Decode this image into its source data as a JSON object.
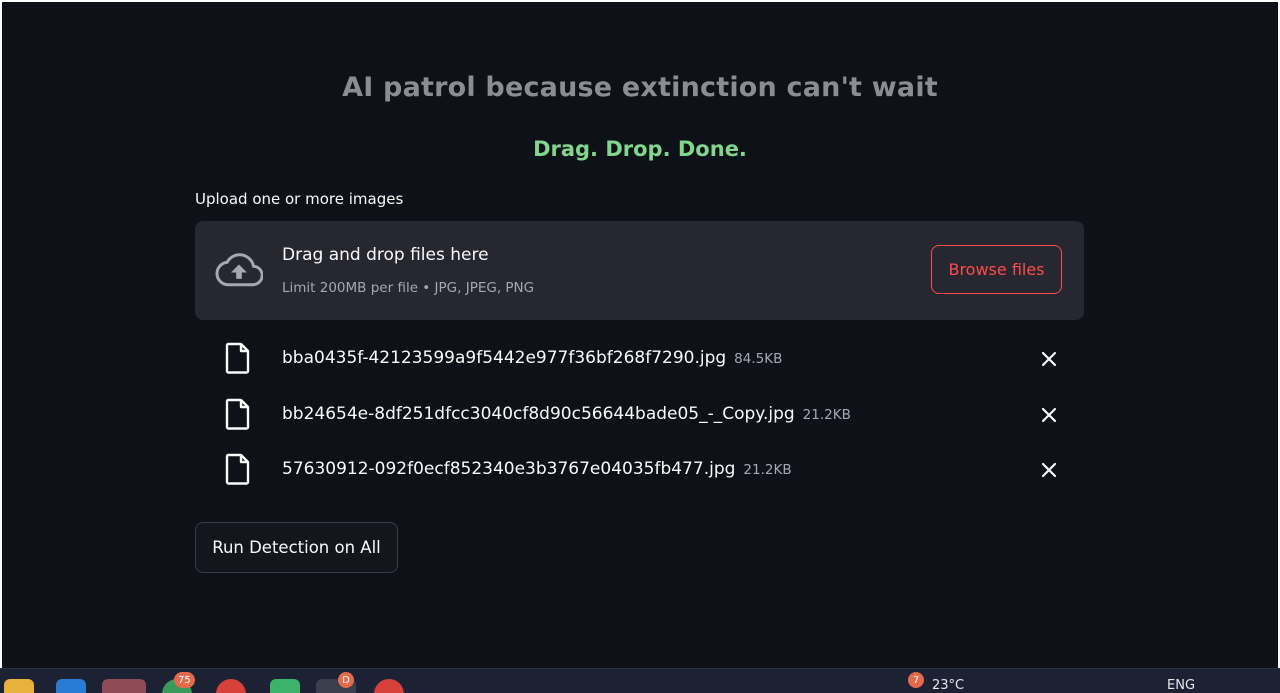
{
  "header": {
    "title": "AI patrol because extinction can't wait",
    "subtitle": "Drag. Drop. Done."
  },
  "uploader": {
    "label": "Upload one or more images",
    "drop_text": "Drag and drop files here",
    "limit_text": "Limit 200MB per file • JPG, JPEG, PNG",
    "browse_label": "Browse files"
  },
  "files": [
    {
      "name": "bba0435f-42123599a9f5442e977f36bf268f7290.jpg",
      "size": "84.5KB"
    },
    {
      "name": "bb24654e-8df251dfcc3040cf8d90c56644bade05_-_Copy.jpg",
      "size": "21.2KB"
    },
    {
      "name": "57630912-092f0ecf852340e3b3767e04035fb477.jpg",
      "size": "21.2KB"
    }
  ],
  "actions": {
    "run_label": "Run Detection on All"
  },
  "taskbar": {
    "badge_chat": "75",
    "badge_app": "D",
    "weather_badge": "7",
    "weather_temp": "23°C",
    "language": "ENG"
  },
  "colors": {
    "background": "#0e1117",
    "accent": "#ff4b4b",
    "subtitle": "#7fd68c",
    "panel": "#262730"
  }
}
